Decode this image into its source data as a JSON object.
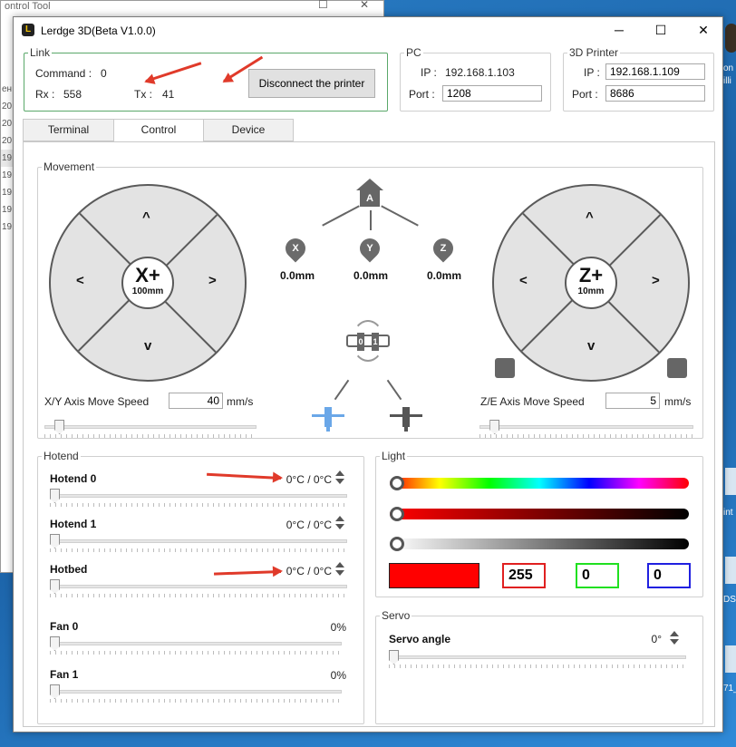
{
  "background_window": {
    "title": "ontrol Tool",
    "side_label": "ен",
    "side_rows": [
      "20",
      "20",
      "20",
      "19",
      "19",
      "19",
      "19",
      "19"
    ]
  },
  "desktop_right": {
    "labels": [
      "on",
      "illi",
      "int",
      "DSI",
      "71_"
    ]
  },
  "window": {
    "title": "Lerdge 3D(Beta V1.0.0)",
    "logo": "L",
    "minimize_glyph": "─",
    "maximize_glyph": "☐",
    "close_glyph": "✕"
  },
  "link": {
    "legend": "Link",
    "command_label": "Command :",
    "command_value": "0",
    "rx_label": "Rx :",
    "rx_value": "558",
    "tx_label": "Tx :",
    "tx_value": "41",
    "disconnect_label": "Disconnect the printer"
  },
  "pc": {
    "legend": "PC",
    "ip_label": "IP :",
    "ip_value": "192.168.1.103",
    "port_label": "Port :",
    "port_value": "1208"
  },
  "printer": {
    "legend": "3D Printer",
    "ip_label": "IP :",
    "ip_value": "192.168.1.109",
    "port_label": "Port :",
    "port_value": "8686"
  },
  "tabs": [
    {
      "label": "Terminal"
    },
    {
      "label": "Control"
    },
    {
      "label": "Device"
    }
  ],
  "movement": {
    "legend": "Movement",
    "xy_pad": {
      "up": "^",
      "down": "v",
      "left": "<",
      "right": ">",
      "axis": "X+",
      "step": "100mm"
    },
    "z_pad": {
      "up": "^",
      "down": "v",
      "left": "<",
      "right": ">",
      "axis": "Z+",
      "step": "10mm"
    },
    "home_letter": "A",
    "axes": [
      {
        "letter": "X",
        "value": "0.0mm"
      },
      {
        "letter": "Y",
        "value": "0.0mm"
      },
      {
        "letter": "Z",
        "value": "0.0mm"
      }
    ],
    "xy_speed_label": "X/Y  Axis Move Speed",
    "xy_speed_value": "40",
    "xy_speed_unit": "mm/s",
    "xy_speed_level": 0.05,
    "ze_speed_label": "Z/E  Axis Move Speed",
    "ze_speed_value": "5",
    "ze_speed_unit": "mm/s",
    "ze_speed_level": 0.05,
    "extruder_labels": [
      "0",
      "1"
    ]
  },
  "hotend": {
    "legend": "Hotend",
    "rows": [
      {
        "label": "Hotend 0",
        "value": "0°C / 0°C",
        "level": 0
      },
      {
        "label": "Hotend 1",
        "value": "0°C / 0°C",
        "level": 0
      },
      {
        "label": "Hotbed",
        "value": "0°C / 0°C",
        "level": 0
      },
      {
        "label": "Fan 0",
        "value": "0%",
        "level": 0
      },
      {
        "label": "Fan 1",
        "value": "0%",
        "level": 0
      }
    ]
  },
  "light": {
    "legend": "Light",
    "r": "255",
    "g": "0",
    "b": "0",
    "preview_color": "#ff0000",
    "r_color": "#e02020",
    "g_color": "#20e020",
    "b_color": "#2020e0"
  },
  "servo": {
    "legend": "Servo",
    "label": "Servo angle",
    "value": "0°",
    "level": 0
  },
  "annotation_color": "#e03a2a"
}
